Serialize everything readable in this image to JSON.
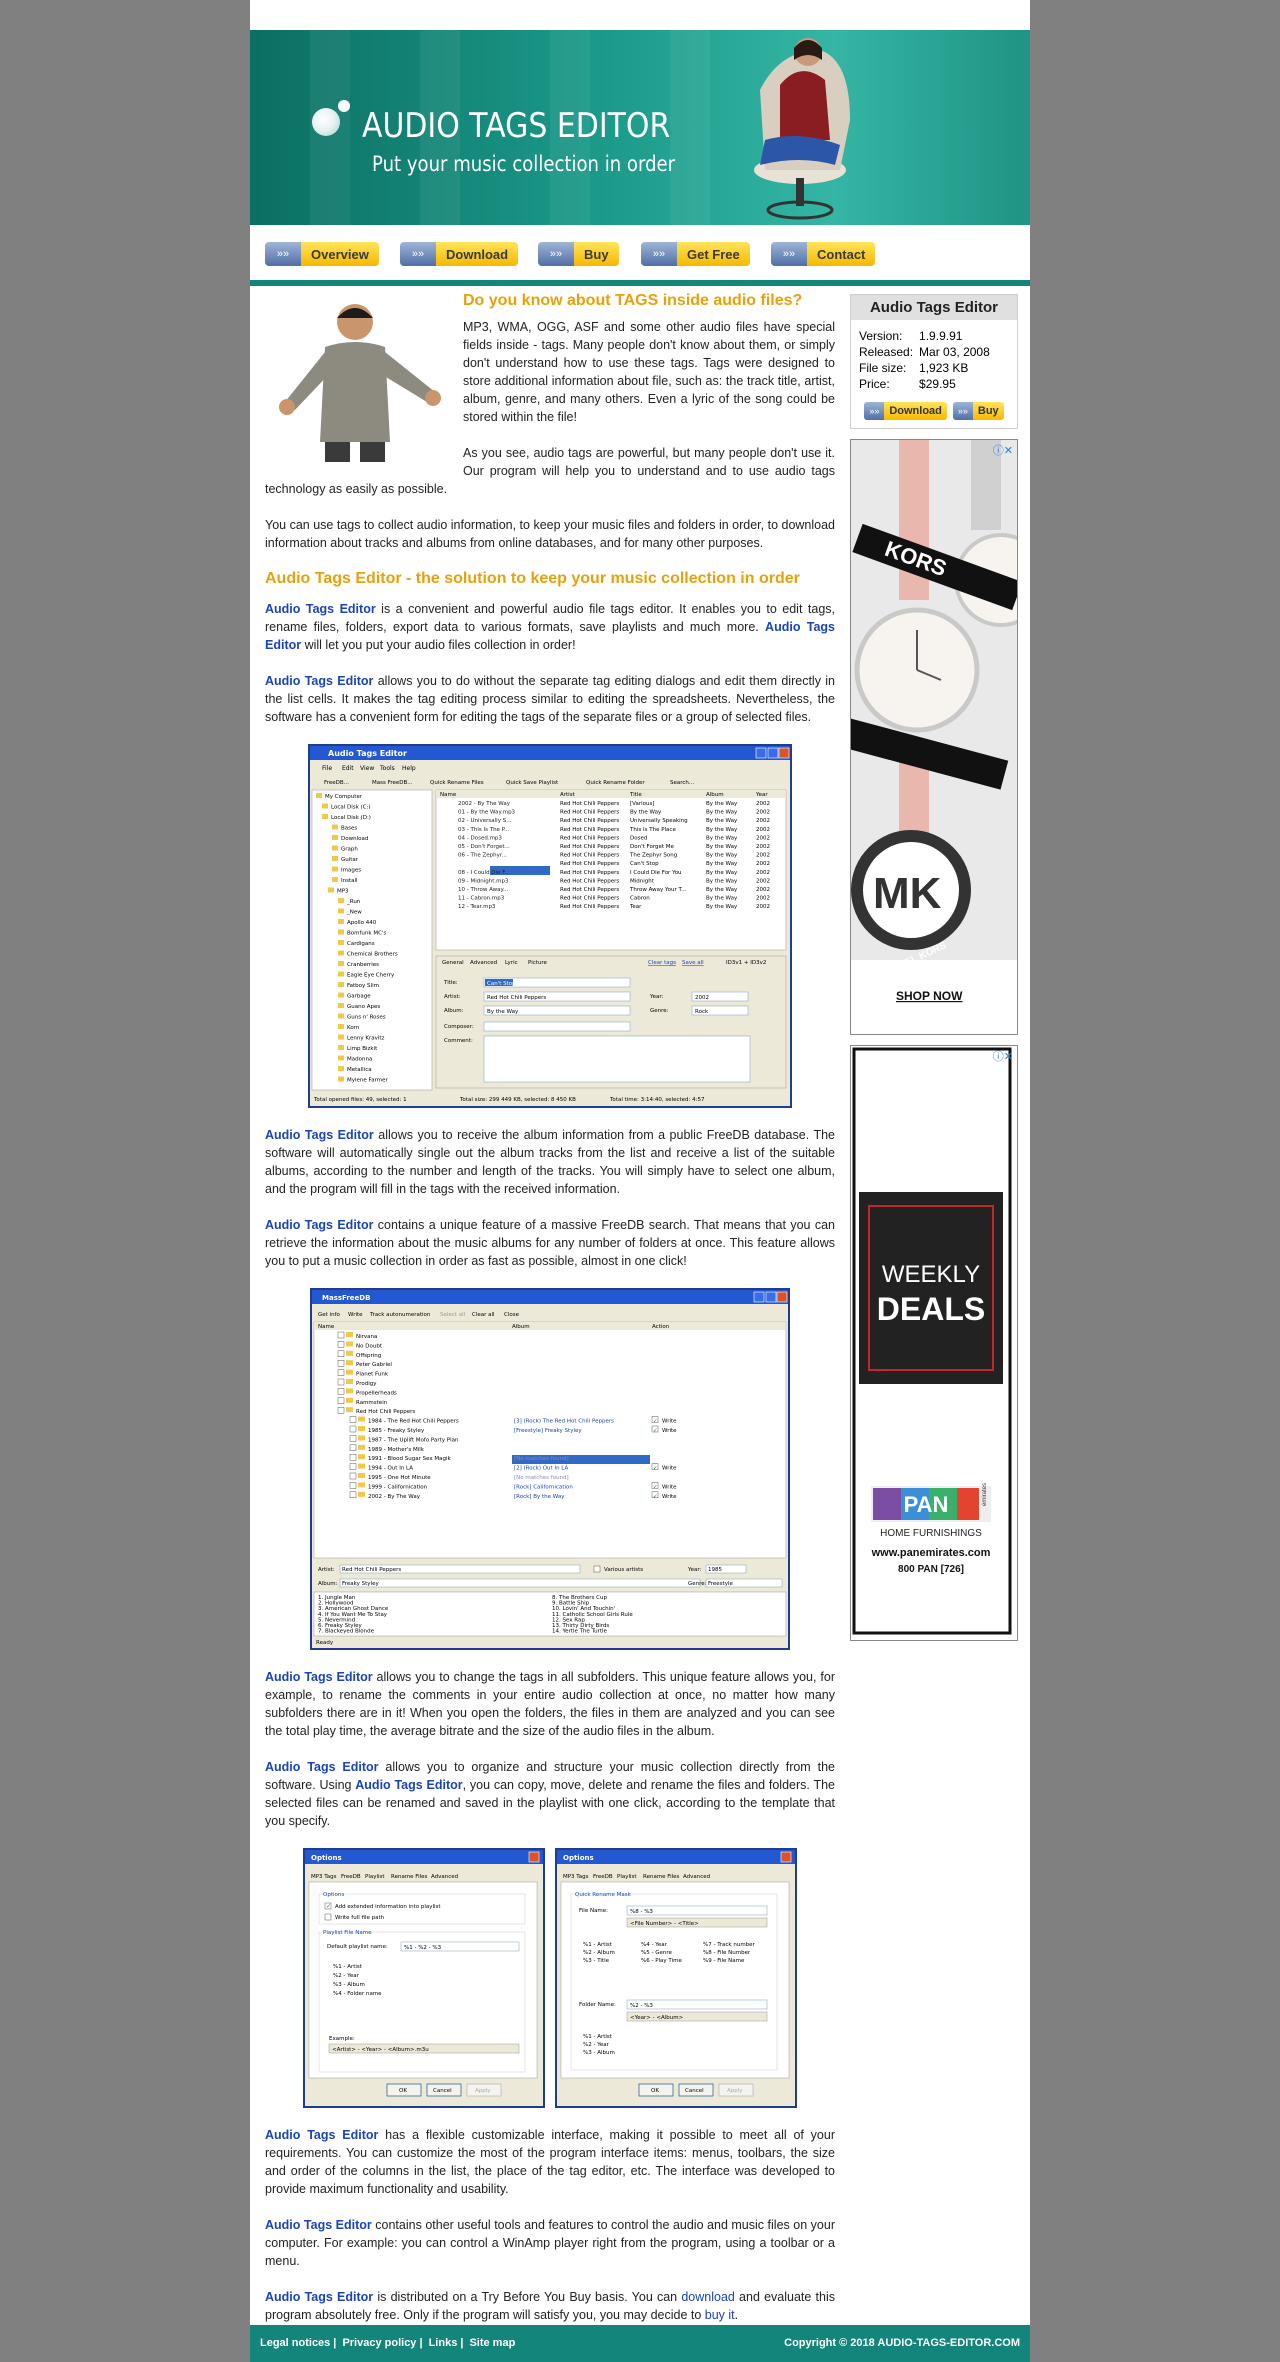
{
  "banner": {
    "title": "AUDIO TAGS EDITOR",
    "subtitle": "Put your music collection in order"
  },
  "nav": [
    "Overview",
    "Download",
    "Buy",
    "Get Free",
    "Contact"
  ],
  "article": {
    "h1": "Do you know about TAGS inside audio files?",
    "p1": "MP3, WMA, OGG, ASF and some other audio files have special fields inside - tags. Many people don't know about them, or simply don't understand how to use these tags. Tags were designed to store additional information about file, such as: the track title, artist, album, genre, and many others. Even a lyric of the song could be stored within the file!",
    "p2": "As you see, audio tags are powerful, but many people don't use it. Our program will help you to understand and to use audio tags technology as easily as possible.",
    "p3": "You can use tags to collect audio information, to keep your music files and folders in order, to download information about tracks and albums from online databases, and for many other purposes.",
    "h2": "Audio Tags Editor - the solution to keep your music collection in order",
    "product": "Audio Tags Editor",
    "p4a": " is a convenient and powerful audio file tags editor. It enables you to edit tags, rename files, folders, export data to various formats, save playlists and much more. ",
    "p4b": " will let you put your audio files collection in order!",
    "p5": " allows you to do without the separate tag editing dialogs and edit them directly in the list cells. It makes the tag editing process similar to editing the spreadsheets. Nevertheless, the software has a convenient form for editing the tags of the separate files or a group of selected files.",
    "p6": " allows you to receive the album information from a public FreeDB database. The software will automatically single out the album tracks from the list and receive a list of the suitable albums, according to the number and length of the tracks. You will simply have to select one album, and the program will fill in the tags with the received information.",
    "p7": " contains a unique feature of a massive FreeDB search. That means that you can retrieve the information about the music albums for any number of folders at once. This feature allows you to put a music collection in order as fast as possible, almost in one click!",
    "p8": " allows you to change the tags in all subfolders. This unique feature allows you, for example, to rename the comments in your entire audio collection at once, no matter how many subfolders there are in it! When you open the folders, the files in them are analyzed and you can see the total play time, the average bitrate and the size of the audio files in the album.",
    "p9a": " allows you to organize and structure your music collection directly from the software. Using ",
    "p9b": ", you can copy, move, delete and rename the files and folders. The selected files can be renamed and saved in the playlist with one click, according to the template that you specify.",
    "p10": " has a flexible customizable interface, making it possible to meet all of your requirements. You can customize the most of the program interface items: menus, toolbars, the size and order of the columns in the list, the place of the tag editor, etc. The interface was developed to provide maximum functionality and usability.",
    "p11": " contains other useful tools and features to control the audio and music files on your computer. For example: you can control a WinAmp player right from the program, using a toolbar or a menu.",
    "p12a": " is distributed on a Try Before You Buy basis. You can ",
    "p12link1": "download",
    "p12b": " and evaluate this program absolutely free. Only if the program will satisfy you, you may decide to ",
    "p12link2": "buy it",
    "p12c": "."
  },
  "shot1": {
    "title": "Audio Tags Editor",
    "menu": [
      "File",
      "Edit",
      "View",
      "Tools",
      "Help"
    ],
    "toolbar": [
      "FreeDB...",
      "Mass FreeDB...",
      "Quick Rename Files",
      "Quick Save Playlist",
      "Quick Rename Folder",
      "Search..."
    ],
    "tree": [
      "My Computer",
      "Local Disk (C:)",
      "Local Disk (D:)",
      "Bases",
      "Download",
      "Graph",
      "Guitar",
      "Images",
      "Install",
      "MP3",
      "_Run",
      "_New",
      "Apollo 440",
      "Bomfunk MC's",
      "Cardigans",
      "Chemical Brothers",
      "Cranberries",
      "Eagle Eye Cherry",
      "Fatboy Slim",
      "Garbage",
      "Guano Apes",
      "Guns n' Roses",
      "Korn",
      "Lenny Kravitz",
      "Limp Bizkit",
      "Madonna",
      "Metallica",
      "Mylene Farmer"
    ],
    "cols": [
      "Name",
      "Artist",
      "Title",
      "Album",
      "Year"
    ],
    "rows": [
      [
        "2002 - By The Way",
        "Red Hot Chili Peppers",
        "[Various]",
        "By the Way",
        "2002"
      ],
      [
        "01 - By the Way.mp3",
        "Red Hot Chili Peppers",
        "By the Way",
        "By the Way",
        "2002"
      ],
      [
        "02 - Universally S...",
        "Red Hot Chili Peppers",
        "Universally Speaking",
        "By the Way",
        "2002"
      ],
      [
        "03 - This Is The P...",
        "Red Hot Chili Peppers",
        "This Is The Place",
        "By the Way",
        "2002"
      ],
      [
        "04 - Dosed.mp3",
        "Red Hot Chili Peppers",
        "Dosed",
        "By the Way",
        "2002"
      ],
      [
        "05 - Don't Forget...",
        "Red Hot Chili Peppers",
        "Don't Forget Me",
        "By the Way",
        "2002"
      ],
      [
        "06 - The Zephyr...",
        "Red Hot Chili Peppers",
        "The Zephyr Song",
        "By the Way",
        "2002"
      ],
      [
        "07 - Can't Stop.mp3",
        "Red Hot Chili Peppers",
        "Can't Stop",
        "By the Way",
        "2002"
      ],
      [
        "08 - I Could Die F...",
        "Red Hot Chili Peppers",
        "I Could Die For You",
        "By the Way",
        "2002"
      ],
      [
        "09 - Midnight.mp3",
        "Red Hot Chili Peppers",
        "Midnight",
        "By the Way",
        "2002"
      ],
      [
        "10 - Throw Away...",
        "Red Hot Chili Peppers",
        "Throw Away Your T...",
        "By the Way",
        "2002"
      ],
      [
        "11 - Cabron.mp3",
        "Red Hot Chili Peppers",
        "Cabron",
        "By the Way",
        "2002"
      ],
      [
        "12 - Tear.mp3",
        "Red Hot Chili Peppers",
        "Tear",
        "By the Way",
        "2002"
      ]
    ],
    "tabs": [
      "General",
      "Advanced",
      "Lyric",
      "Picture"
    ],
    "links": [
      "Clear tags",
      "Save all"
    ],
    "tagver": "ID3v1 + ID3v2",
    "fields": {
      "title_label": "Title:",
      "title": "Can't Stop",
      "artist_label": "Artist:",
      "artist": "Red Hot Chili Peppers",
      "album_label": "Album:",
      "album": "By the Way",
      "composer_label": "Composer:",
      "comment_label": "Comment:",
      "year_label": "Year:",
      "year": "2002",
      "genre_label": "Genre:",
      "genre": "Rock"
    },
    "status": [
      "Total opened files: 49, selected: 1",
      "Total size: 299 449 KB, selected: 8 450 KB",
      "Total time: 3:14:40, selected: 4:57"
    ]
  },
  "shot2": {
    "title": "MassFreeDB",
    "toolbar": [
      "Get info",
      "Write",
      "Track autonumeration",
      "Select all",
      "Clear all",
      "Close"
    ],
    "cols": [
      "Name",
      "Album",
      "Action"
    ],
    "rows": [
      [
        "Nirvana",
        "",
        ""
      ],
      [
        "No Doubt",
        "",
        ""
      ],
      [
        "Offspring",
        "",
        ""
      ],
      [
        "Peter Gabriel",
        "",
        ""
      ],
      [
        "Planet Funk",
        "",
        ""
      ],
      [
        "Prodigy",
        "",
        ""
      ],
      [
        "Propellerheads",
        "",
        ""
      ],
      [
        "Rammstein",
        "",
        ""
      ],
      [
        "Red Hot Chili Peppers",
        "",
        ""
      ],
      [
        "1984 - The Red Hot Chili Peppers",
        "[3] (Rock) The Red Hot Chili Peppers",
        "Write"
      ],
      [
        "1985 - Freaky Styley",
        "[Freestyle] Freaky Styley",
        "Write"
      ],
      [
        "1987 - The Uplift Mofo Party Plan",
        "[Rock] Freaky Styley",
        ""
      ],
      [
        "1989 - Mother's Milk",
        "",
        ""
      ],
      [
        "1991 - Blood Sugar Sex Magik",
        "[No matches found]",
        ""
      ],
      [
        "1994 - Out In LA",
        "[2] (Rock) Out In LA",
        "Write"
      ],
      [
        "1995 - One Hot Minute",
        "[No matches found]",
        ""
      ],
      [
        "1999 - Californication",
        "[Rock] Californication",
        "Write"
      ],
      [
        "2002 - By The Way",
        "[Rock] By the Way",
        "Write"
      ]
    ],
    "artist_label": "Artist:",
    "artist": "Red Hot Chili Peppers",
    "various": "Various artists",
    "year_label": "Year:",
    "year": "1985",
    "album_label": "Album:",
    "album": "Freaky Styley",
    "genre_label": "Genre:",
    "genre": "Freestyle",
    "tracks_left": [
      "1. Jungle Man",
      "2. Hollywood",
      "3. American Ghost Dance",
      "4. If You Want Me To Stay",
      "5. Nevermind",
      "6. Freaky Styley",
      "7. Blackeyed Blonde"
    ],
    "tracks_right": [
      "8. The Brothers Cup",
      "9. Battle Ship",
      "10. Lovin' And Touchin'",
      "11. Catholic School Girls Rule",
      "12. Sex Rap",
      "13. Thirty Dirty Birds",
      "14. Yertle The Turtle"
    ],
    "status": "Ready"
  },
  "shot3": {
    "title": "Options",
    "tabs": [
      "MP3 Tags",
      "FreeDB",
      "Playlist",
      "Rename Files",
      "Advanced"
    ],
    "options_label": "Options",
    "chk1": "Add extended information into playlist",
    "chk2": "Write full file path",
    "group2": "Playlist File Name",
    "default_label": "Default playlist name:",
    "default_value": "%1 - %2 - %3",
    "vars": [
      "%1 - Artist",
      "%2 - Year",
      "%3 - Album",
      "%4 - Folder name"
    ],
    "example_label": "Example:",
    "example": "<Artist> - <Year> - <Album>.m3u",
    "buttons": [
      "OK",
      "Cancel",
      "Apply"
    ]
  },
  "shot4": {
    "title": "Options",
    "tabs": [
      "MP3 Tags",
      "FreeDB",
      "Playlist",
      "Rename Files",
      "Advanced"
    ],
    "group": "Quick Rename Mask",
    "file_label": "File Name:",
    "file_value": "%8 - %3",
    "file_example": "<File Number> - <Title>",
    "vars_a": [
      "%1 - Artist",
      "%2 - Album",
      "%3 - Title"
    ],
    "vars_b": [
      "%4 - Year",
      "%5 - Genre",
      "%6 - Play Time"
    ],
    "vars_c": [
      "%7 - Track number",
      "%8 - File Number",
      "%9 - File Name"
    ],
    "folder_label": "Folder Name:",
    "folder_value": "%2 - %3",
    "folder_example": "<Year> - <Album>",
    "fvars": [
      "%1 - Artist",
      "%2 - Year",
      "%3 - Album"
    ],
    "buttons": [
      "OK",
      "Cancel",
      "Apply"
    ]
  },
  "sidebar": {
    "title": "Audio Tags Editor",
    "rows": [
      {
        "k": "Version:",
        "v": "1.9.9.91"
      },
      {
        "k": "Released:",
        "v": "Mar 03, 2008"
      },
      {
        "k": "File size:",
        "v": "1,923 KB"
      },
      {
        "k": "Price:",
        "v": "$29.95"
      }
    ],
    "download": "Download",
    "buy": "Buy"
  },
  "ad1": {
    "brand1": "KORS",
    "brand2": "MICHAEL KORS",
    "cta": "SHOP NOW"
  },
  "ad2": {
    "line1": "WEEKLY",
    "line2": "DEALS",
    "logo": "PAN",
    "logo_small": "emirates",
    "logo_sub": "HOME FURNISHINGS",
    "url": "www.panemirates.com",
    "phone": "800 PAN [726]"
  },
  "footer": {
    "links": [
      "Legal notices",
      "Privacy policy",
      "Links",
      "Site map"
    ],
    "copyright": "Copyright © 2018 AUDIO-TAGS-EDITOR.COM"
  },
  "colors": {
    "teal": "#13857a",
    "heading": "#e8a10c",
    "link": "#1a44b8"
  }
}
